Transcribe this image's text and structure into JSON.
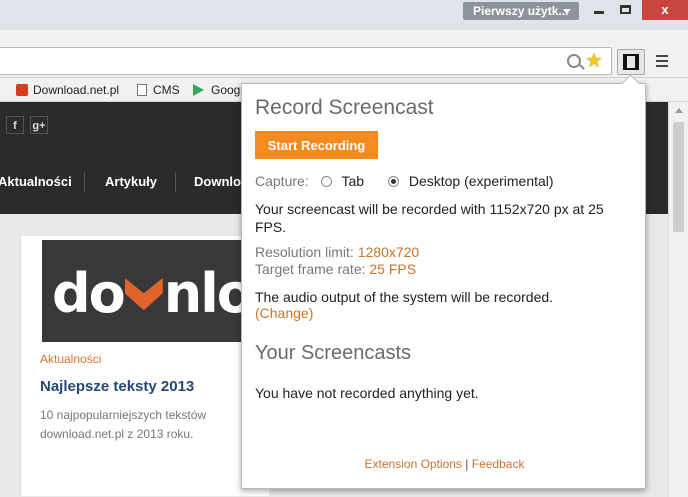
{
  "browser": {
    "profile_label": "Pierwszy użytk...",
    "close_glyph": "x",
    "bookmarks": [
      {
        "label": "Download.net.pl",
        "icon": "download-shield-icon"
      },
      {
        "label": "CMS",
        "icon": "page-icon"
      },
      {
        "label": "Goog",
        "icon": "play-store-icon"
      }
    ]
  },
  "page": {
    "social": [
      "f",
      "g+"
    ],
    "nav": [
      "Aktualności",
      "Artykuły",
      "Downlo"
    ],
    "logo_parts": [
      "do",
      "nloa"
    ],
    "article": {
      "category": "Aktualności",
      "title": "Najlepsze teksty 2013",
      "description": "10 najpopularniejszych tekstów download.net.pl z 2013 roku."
    }
  },
  "popup": {
    "title": "Record Screencast",
    "start_button": "Start Recording",
    "capture_label": "Capture:",
    "capture_options": [
      {
        "label": "Tab",
        "selected": false
      },
      {
        "label": "Desktop (experimental)",
        "selected": true
      }
    ],
    "record_info": "Your screencast will be recorded with 1152x720 px at 25 FPS.",
    "resolution_label": "Resolution limit:",
    "resolution_value": "1280x720",
    "framerate_label": "Target frame rate:",
    "framerate_value": "25 FPS",
    "audio_info": "The audio output of the system will be recorded.",
    "change_link": "(Change)",
    "screencasts_title": "Your Screencasts",
    "empty_message": "You have not recorded anything yet.",
    "footer_options": "Extension Options",
    "footer_separator": "|",
    "footer_feedback": "Feedback"
  },
  "colors": {
    "accent": "#f58a1f",
    "link": "#c9742a",
    "logo_chevron": "#e1642a",
    "article_title": "#254a7a"
  }
}
